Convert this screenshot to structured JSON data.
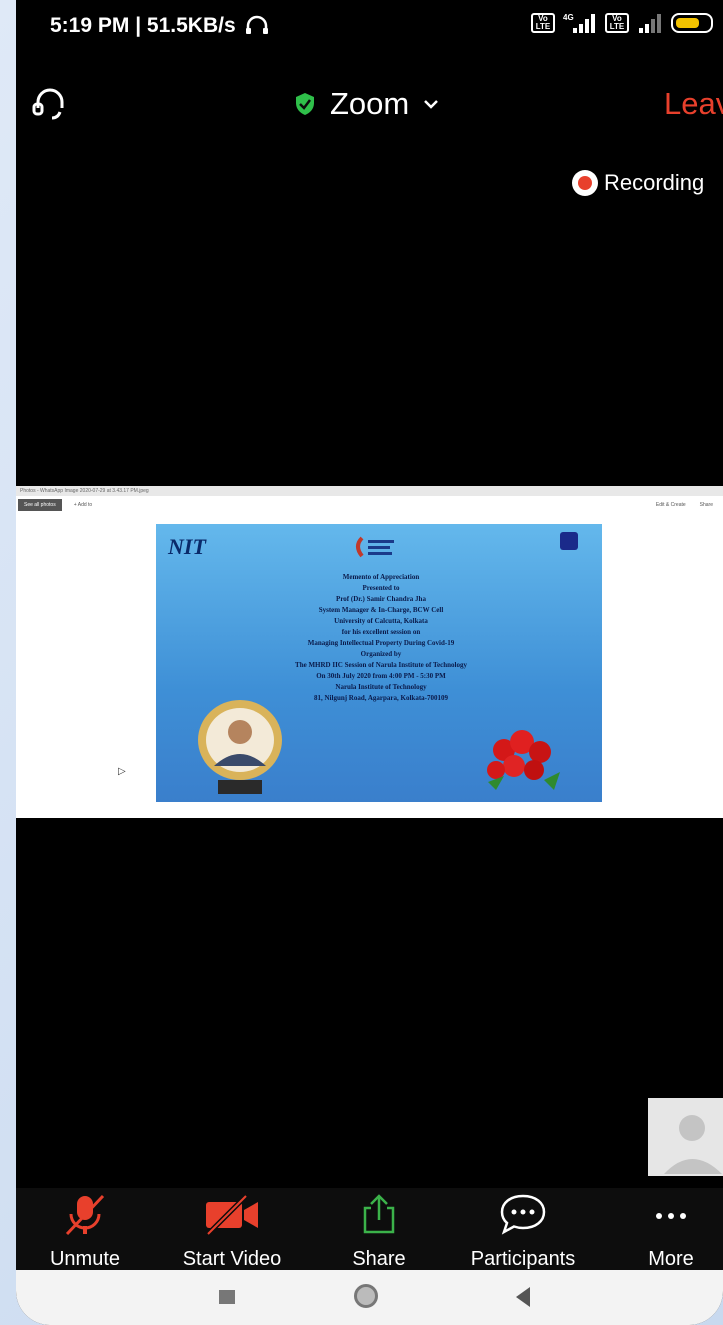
{
  "status": {
    "time_speed": "5:19 PM | 51.5KB/s",
    "volte1": "Vo LTE",
    "volte2": "Vo LTE",
    "network": "4G",
    "battery": "55"
  },
  "header": {
    "app_title": "Zoom",
    "leave_label": "Leave",
    "shield_color": "#2fbf4a",
    "leave_color": "#e8402c"
  },
  "recording": {
    "label": "Recording"
  },
  "shared_screen": {
    "window_title": "Photos - WhatsApp Image 2020-07-29 at 3.43.17 PM.jpeg",
    "toolbar_left": "See all photos",
    "toolbar_add": "+ Add to",
    "toolbar_edit": "Edit & Create",
    "toolbar_share": "Share",
    "certificate": {
      "logo_left": "NIT",
      "lines": [
        "Memento of Appreciation",
        "Presented to",
        "Prof (Dr.) Samir Chandra Jha",
        "System Manager & In-Charge, BCW Cell",
        "University of Calcutta, Kolkata",
        "for his excellent session on",
        "Managing Intellectual Property During Covid-19",
        "Organized by",
        "The MHRD IIC Session of Narula Institute of Technology",
        "On 30th July 2020 from 4:00 PM - 5:30 PM",
        "Narula Institute of Technology",
        "81, Nilgunj Road, Agarpara, Kolkata-700109"
      ]
    }
  },
  "toolbar": {
    "unmute": "Unmute",
    "start_video": "Start Video",
    "share": "Share",
    "participants": "Participants",
    "more": "More",
    "red_color": "#e8402c",
    "green_color": "#3bb24a"
  }
}
